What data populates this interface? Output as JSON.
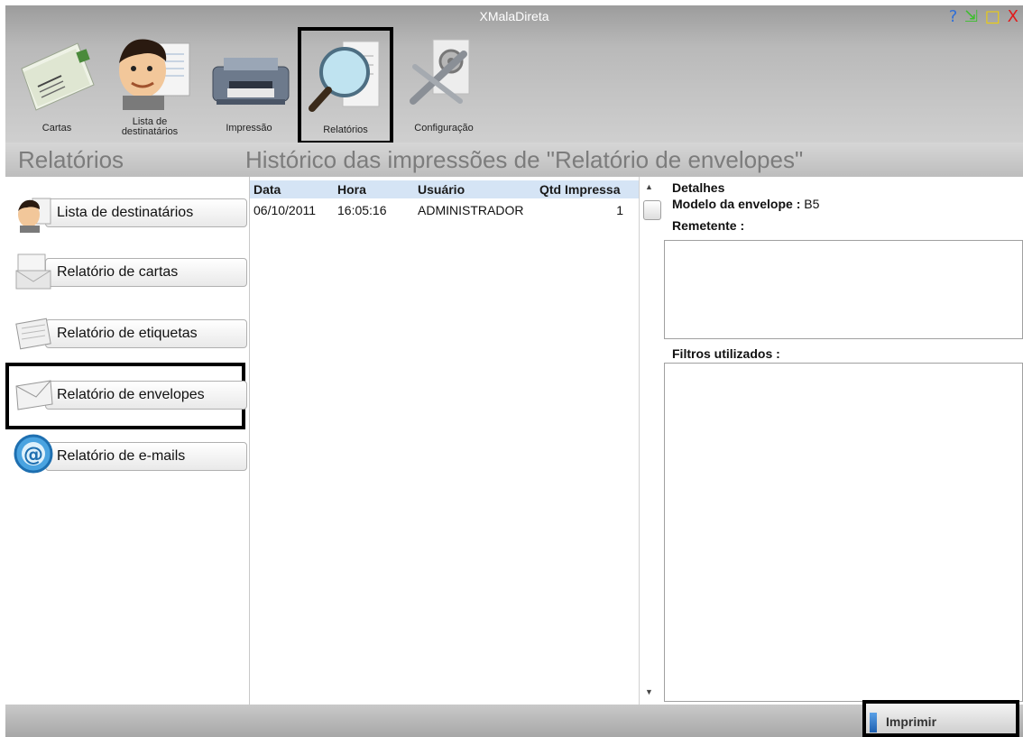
{
  "window": {
    "title": "XMalaDireta",
    "controls": {
      "help": "?",
      "minimize": "⇲",
      "maximize": "□",
      "close": "X"
    },
    "colors": {
      "help": "#2f6fd8",
      "minimize": "#3bbf2b",
      "maximize": "#f2d000",
      "close": "#e21b1b"
    }
  },
  "toolbar": {
    "items": [
      {
        "label": "Cartas",
        "icon": "letters-icon"
      },
      {
        "label_line1": "Lista de",
        "label_line2": "destinatários",
        "icon": "person-list-icon"
      },
      {
        "label": "Impressão",
        "icon": "printer-icon"
      },
      {
        "label": "Relatórios",
        "icon": "magnifier-report-icon",
        "selected": true
      },
      {
        "label": "Configuração",
        "icon": "settings-tools-icon"
      }
    ]
  },
  "header": {
    "left_title": "Relatórios",
    "right_title": "Histórico das impressões de \"Relatório de envelopes\""
  },
  "sidebar": {
    "items": [
      {
        "label": "Lista de destinatários",
        "icon": "person-icon"
      },
      {
        "label": "Relatório de cartas",
        "icon": "letter-icon"
      },
      {
        "label": "Relatório de etiquetas",
        "icon": "label-sheet-icon"
      },
      {
        "label": "Relatório de envelopes",
        "icon": "envelope-icon",
        "selected": true
      },
      {
        "label": "Relatório de e-mails",
        "icon": "at-sign-icon"
      }
    ]
  },
  "grid": {
    "columns": [
      "Data",
      "Hora",
      "Usuário",
      "Qtd Impressa"
    ],
    "rows": [
      {
        "data": "06/10/2011",
        "hora": "16:05:16",
        "usuario": "ADMINISTRADOR",
        "qtd": "1"
      }
    ],
    "header_color": "#d5e4f5"
  },
  "details": {
    "title": "Detalhes",
    "modelo_label": "Modelo da envelope :",
    "modelo_value": "B5",
    "remetente_label": "Remetente :",
    "filtros_label": "Filtros utilizados :"
  },
  "footer": {
    "print_label": "Imprimir"
  }
}
